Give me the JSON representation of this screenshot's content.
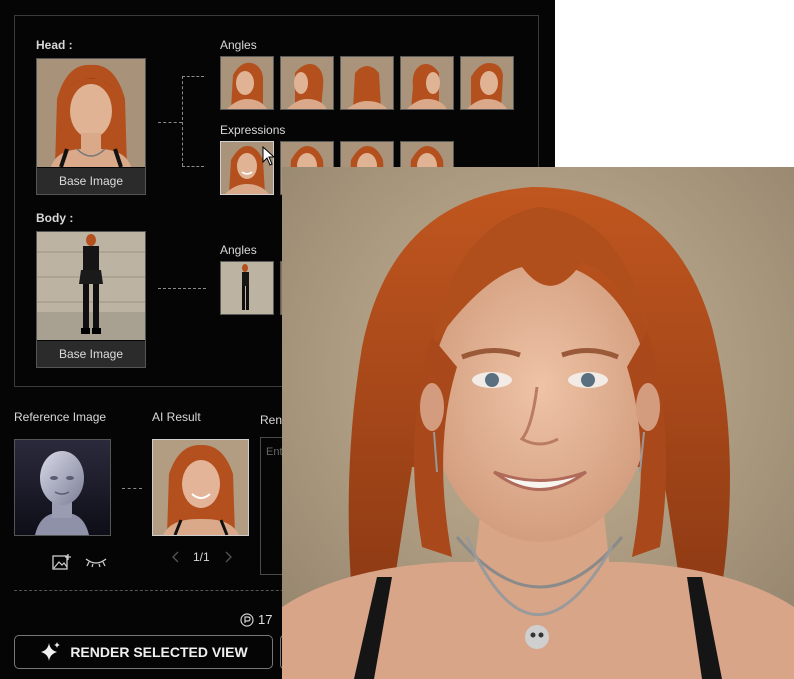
{
  "head": {
    "label": "Head :",
    "base_image_label": "Base Image"
  },
  "body": {
    "label": "Body :",
    "base_image_label": "Base Image"
  },
  "head_angles_label": "Angles",
  "expressions_label": "Expressions",
  "body_angles_label": "Angles",
  "reference": {
    "label": "Reference Image"
  },
  "ai_result": {
    "label": "AI Result",
    "pager": "1/1",
    "prev_icon": "chevron-left-icon",
    "next_icon": "chevron-right-icon"
  },
  "render_prompt": {
    "label_fragment": "Ren",
    "placeholder_fragment": "Ent"
  },
  "credits": {
    "value": "17",
    "icon": "credit-icon"
  },
  "render_button": {
    "label": "RENDER SELECTED VIEW",
    "icon": "sparkle-icon"
  },
  "icons": {
    "add_image": "add-image-icon",
    "hide": "eye-closed-icon",
    "cursor": "mouse-cursor-icon"
  },
  "colors": {
    "background": "#050505",
    "hair": "#b4501e",
    "skin": "#e3b497",
    "backdrop": "#b9a58b"
  }
}
